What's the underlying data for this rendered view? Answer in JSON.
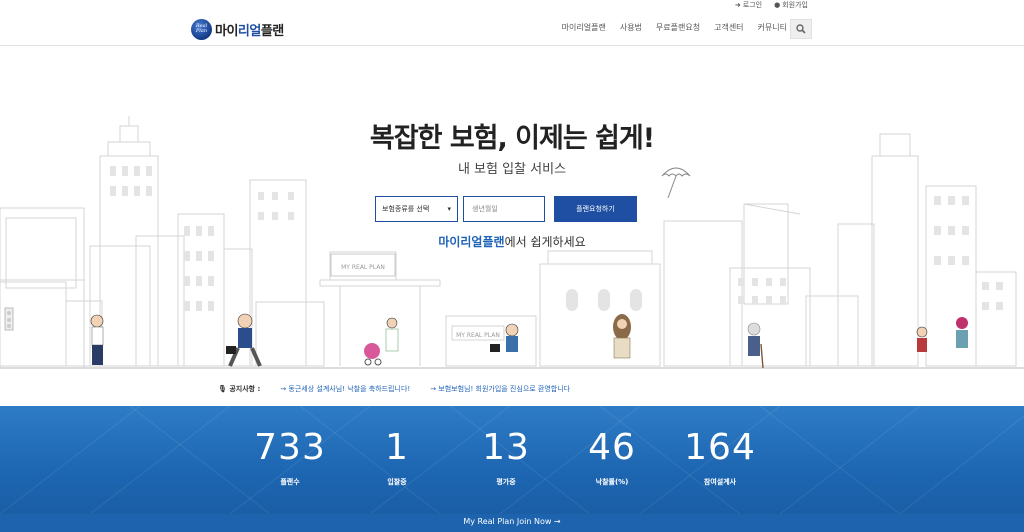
{
  "utility": {
    "login": "로그인",
    "signup": "회원가입"
  },
  "header": {
    "logo_badge": "Real Plan",
    "logo_name_prefix": "마이",
    "logo_name_accent": "리얼",
    "logo_name_suffix": "플랜",
    "nav": [
      "마이리얼플랜",
      "사용법",
      "무료플랜요청",
      "고객센터",
      "커뮤니티"
    ]
  },
  "hero": {
    "headline": "복잡한 보험, 이제는 쉽게!",
    "subline": "내 보험 입찰 서비스",
    "select_label": "보험종류를 선택",
    "input_placeholder": "생년월일",
    "submit_label": "플랜요청하기",
    "tagline_accent": "마이리얼플랜",
    "tagline_rest": "에서 쉽게하세요",
    "sign_text": "MY REAL PLAN",
    "bus_text": "MY REAL PLAN"
  },
  "notice": {
    "label": "공지사항 :",
    "items": [
      "→ 동근세상 설계사님! 낙찰을 축하드립니다!",
      "→ 보험보험님! 회원가입을 진심으로 환영합니다"
    ]
  },
  "stats": [
    {
      "value": "733",
      "label": "플랜수"
    },
    {
      "value": "1",
      "label": "입찰중"
    },
    {
      "value": "13",
      "label": "평가중"
    },
    {
      "value": "46",
      "label": "낙찰률(%)"
    },
    {
      "value": "164",
      "label": "참여설계사"
    }
  ],
  "join": "My Real Plan Join Now →",
  "colors": {
    "brand": "#1f4fa3",
    "stats_bg": "#1d66b2",
    "accent_text": "#1f63b8"
  }
}
